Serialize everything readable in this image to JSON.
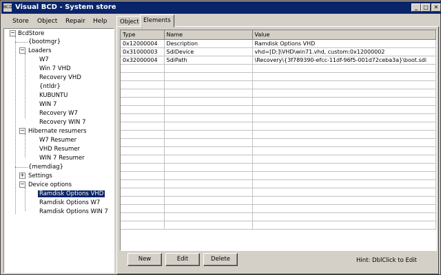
{
  "window": {
    "title": "Visual BCD - System store",
    "icon_text": "BCD"
  },
  "menu": [
    "Store",
    "Object",
    "Repair",
    "Help"
  ],
  "tree": {
    "root": "BcdStore",
    "bootmgr": "{bootmgr}",
    "loaders": {
      "label": "Loaders",
      "items": [
        "W7",
        "Win 7 VHD",
        "Recovery VHD",
        "{ntldr}",
        "KUBUNTU",
        "WIN 7",
        "Recovery W7",
        "Recovery WIN 7"
      ]
    },
    "hibernate": {
      "label": "Hibernate resumers",
      "items": [
        "W7 Resumer",
        "VHD Resumer",
        "WIN 7 Resumer"
      ]
    },
    "memdiag": "{memdiag}",
    "settings": "Settings",
    "device": {
      "label": "Device options",
      "items": [
        "Ramdisk Options VHD",
        "Ramdisk Options W7",
        "Ramdisk Options WIN 7"
      ],
      "selected": "Ramdisk Options VHD"
    }
  },
  "tabs": [
    "Object",
    "Elements"
  ],
  "active_tab": "Elements",
  "grid": {
    "columns": [
      "Type",
      "Name",
      "Value"
    ],
    "rows": [
      [
        "0x12000004",
        "Description",
        "Ramdisk Options VHD"
      ],
      [
        "0x31000003",
        "SdiDevice",
        "vhd=[D:]\\VHD\\win71.vhd, custom:0x12000002"
      ],
      [
        "0x32000004",
        "SdiPath",
        "\\Recovery\\{3f789390-efcc-11df-96f5-001d72ceba3a}\\boot.sdi"
      ]
    ]
  },
  "buttons": {
    "new": "New",
    "edit": "Edit",
    "delete": "Delete"
  },
  "hint": "Hint: DblClick to Edit"
}
